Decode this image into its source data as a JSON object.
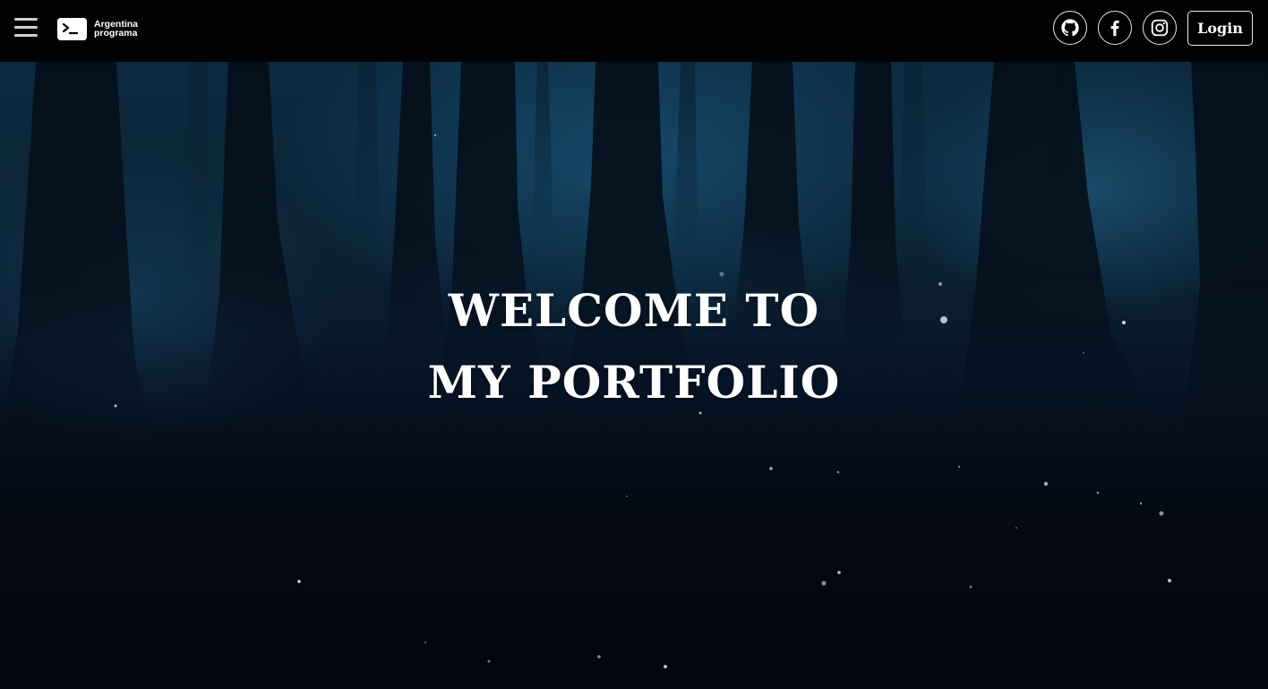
{
  "navbar": {
    "menu_icon": "hamburger-menu-icon",
    "brand": {
      "logo_icon": "terminal-prompt-icon",
      "line1": "Argentina",
      "line2": "programa"
    },
    "social": [
      {
        "name": "github",
        "icon": "github-icon"
      },
      {
        "name": "facebook",
        "icon": "facebook-icon"
      },
      {
        "name": "instagram",
        "icon": "instagram-icon"
      }
    ],
    "login_label": "Login"
  },
  "hero": {
    "title_line1": "WELCOME TO",
    "title_line2": "MY PORTFOLIO",
    "background": "dark-forest-image"
  },
  "colors": {
    "navbar_bg": "#020202",
    "text": "#ffffff",
    "hero_top": "#0d2a3f",
    "hero_bottom": "#03070f"
  }
}
